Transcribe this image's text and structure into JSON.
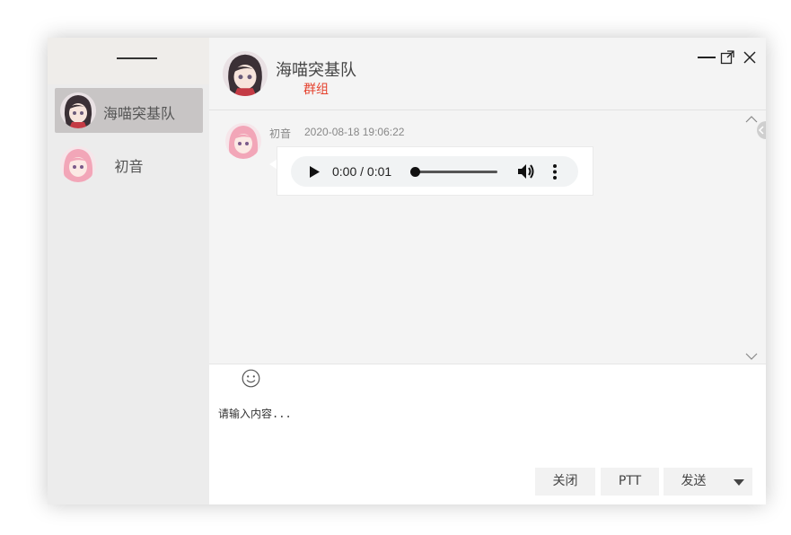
{
  "contacts": [
    {
      "name": "海喵突基队",
      "active": true
    },
    {
      "name": "初音",
      "active": false
    }
  ],
  "chat_header": {
    "title": "海喵突基队",
    "subtitle": "群组"
  },
  "messages": [
    {
      "sender": "初音",
      "time": "2020-08-18 19:06:22",
      "audio": {
        "time_display": "0:00 / 0:01"
      }
    }
  ],
  "input": {
    "placeholder": "请输入内容..."
  },
  "buttons": {
    "close": "关闭",
    "ptt": "PTT",
    "send": "发送"
  },
  "colors": {
    "accent_subtitle": "#e5412d",
    "active_contact_bg": "#c8c5c5"
  }
}
